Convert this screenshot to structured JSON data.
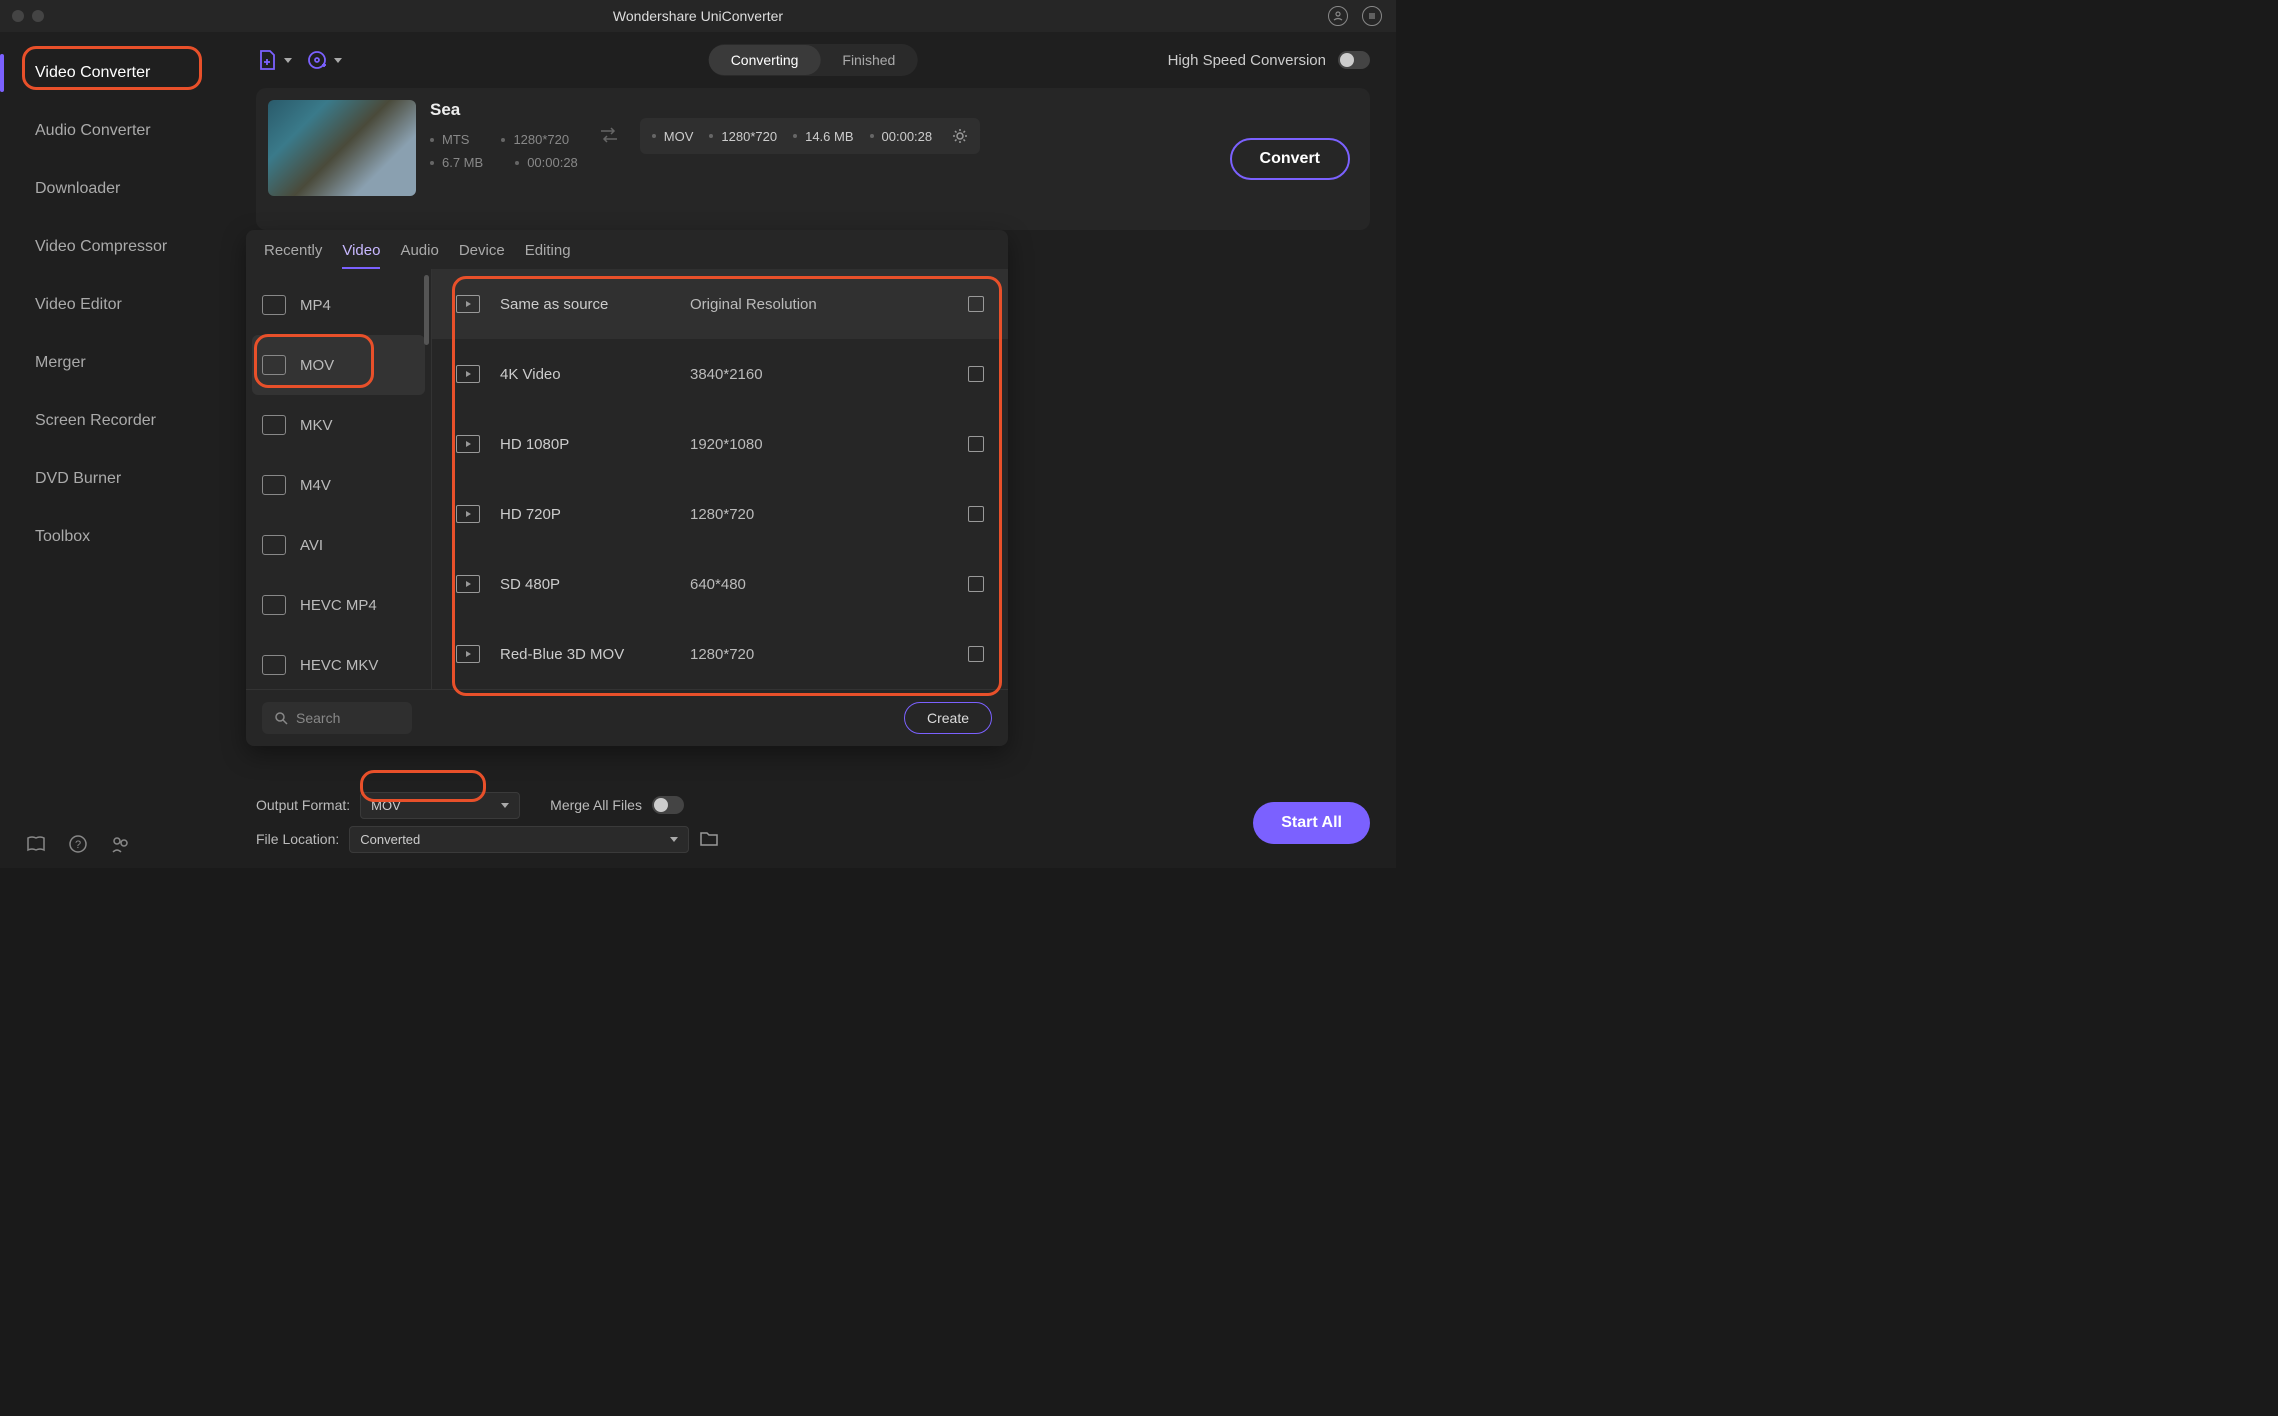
{
  "title": "Wondershare UniConverter",
  "sidebar": {
    "items": [
      {
        "label": "Video Converter"
      },
      {
        "label": "Audio Converter"
      },
      {
        "label": "Downloader"
      },
      {
        "label": "Video Compressor"
      },
      {
        "label": "Video Editor"
      },
      {
        "label": "Merger"
      },
      {
        "label": "Screen Recorder"
      },
      {
        "label": "DVD Burner"
      },
      {
        "label": "Toolbox"
      }
    ]
  },
  "toolbar": {
    "segment": {
      "converting": "Converting",
      "finished": "Finished"
    },
    "highspeed_label": "High Speed Conversion"
  },
  "file": {
    "name": "Sea",
    "src": {
      "container": "MTS",
      "res": "1280*720",
      "size": "6.7 MB",
      "dur": "00:00:28"
    },
    "out": {
      "container": "MOV",
      "res": "1280*720",
      "size": "14.6 MB",
      "dur": "00:00:28"
    },
    "convert_label": "Convert"
  },
  "dropdown": {
    "tabs": {
      "recently": "Recently",
      "video": "Video",
      "audio": "Audio",
      "device": "Device",
      "editing": "Editing"
    },
    "formats": [
      {
        "label": "MP4"
      },
      {
        "label": "MOV"
      },
      {
        "label": "MKV"
      },
      {
        "label": "M4V"
      },
      {
        "label": "AVI"
      },
      {
        "label": "HEVC MP4"
      },
      {
        "label": "HEVC MKV"
      }
    ],
    "presets": [
      {
        "name": "Same as source",
        "res": "Original Resolution"
      },
      {
        "name": "4K Video",
        "res": "3840*2160"
      },
      {
        "name": "HD 1080P",
        "res": "1920*1080"
      },
      {
        "name": "HD 720P",
        "res": "1280*720"
      },
      {
        "name": "SD 480P",
        "res": "640*480"
      },
      {
        "name": "Red-Blue 3D MOV",
        "res": "1280*720"
      }
    ],
    "search_placeholder": "Search",
    "create_label": "Create"
  },
  "bottom": {
    "output_format_label": "Output Format:",
    "output_format_value": "MOV",
    "merge_label": "Merge All Files",
    "file_location_label": "File Location:",
    "file_location_value": "Converted",
    "start_all_label": "Start All"
  }
}
